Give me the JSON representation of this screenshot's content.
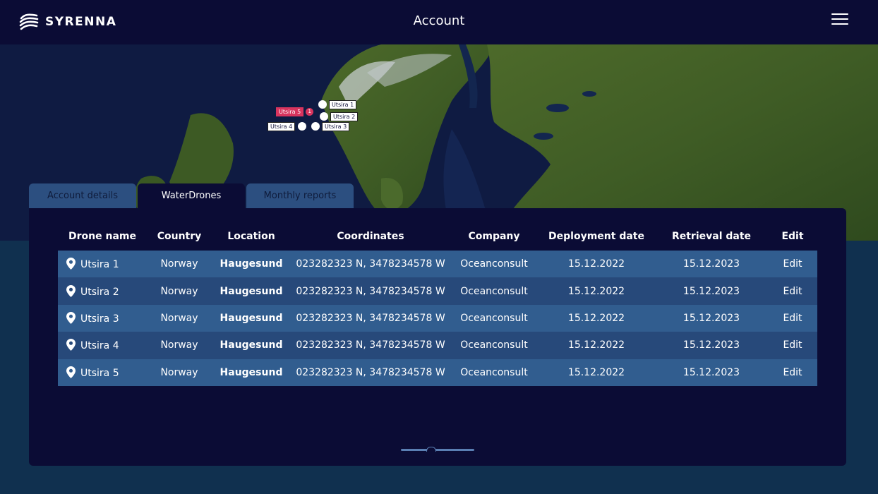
{
  "header": {
    "brand": "SYRENNA",
    "title": "Account"
  },
  "map": {
    "markers": [
      {
        "label": "Utsira 1",
        "alert": false
      },
      {
        "label": "Utsira 2",
        "alert": false
      },
      {
        "label": "Utsira 3",
        "alert": false
      },
      {
        "label": "Utsira 4",
        "alert": false
      },
      {
        "label": "Utsira 5",
        "alert": true,
        "alert_count": "1"
      }
    ]
  },
  "tabs": [
    {
      "label": "Account details",
      "active": false
    },
    {
      "label": "WaterDrones",
      "active": true
    },
    {
      "label": "Monthly reports",
      "active": false
    }
  ],
  "table": {
    "columns": [
      "Drone name",
      "Country",
      "Location",
      "Coordinates",
      "Company",
      "Deployment date",
      "Retrieval date",
      "Edit"
    ],
    "rows": [
      {
        "name": "Utsira 1",
        "country": "Norway",
        "location": "Haugesund",
        "coordinates": "023282323 N, 3478234578 W",
        "company": "Oceanconsult",
        "deployment": "15.12.2022",
        "retrieval": "15.12.2023",
        "edit": "Edit"
      },
      {
        "name": "Utsira 2",
        "country": "Norway",
        "location": "Haugesund",
        "coordinates": "023282323 N, 3478234578 W",
        "company": "Oceanconsult",
        "deployment": "15.12.2022",
        "retrieval": "15.12.2023",
        "edit": "Edit"
      },
      {
        "name": "Utsira 3",
        "country": "Norway",
        "location": "Haugesund",
        "coordinates": "023282323 N, 3478234578 W",
        "company": "Oceanconsult",
        "deployment": "15.12.2022",
        "retrieval": "15.12.2023",
        "edit": "Edit"
      },
      {
        "name": "Utsira 4",
        "country": "Norway",
        "location": "Haugesund",
        "coordinates": "023282323 N, 3478234578 W",
        "company": "Oceanconsult",
        "deployment": "15.12.2022",
        "retrieval": "15.12.2023",
        "edit": "Edit"
      },
      {
        "name": "Utsira 5",
        "country": "Norway",
        "location": "Haugesund",
        "coordinates": "023282323 N, 3478234578 W",
        "company": "Oceanconsult",
        "deployment": "15.12.2022",
        "retrieval": "15.12.2023",
        "edit": "Edit"
      }
    ]
  },
  "colors": {
    "header_bg": "#0b0c35",
    "page_bg": "#10304f",
    "row_light": "#315d8f",
    "row_dark": "#27497a",
    "tab_inactive": "#2c4f80",
    "alert": "#d9345e"
  },
  "icons": {
    "logo": "wave-logo-icon",
    "menu": "hamburger-menu-icon",
    "row_pin": "map-pin-icon"
  }
}
